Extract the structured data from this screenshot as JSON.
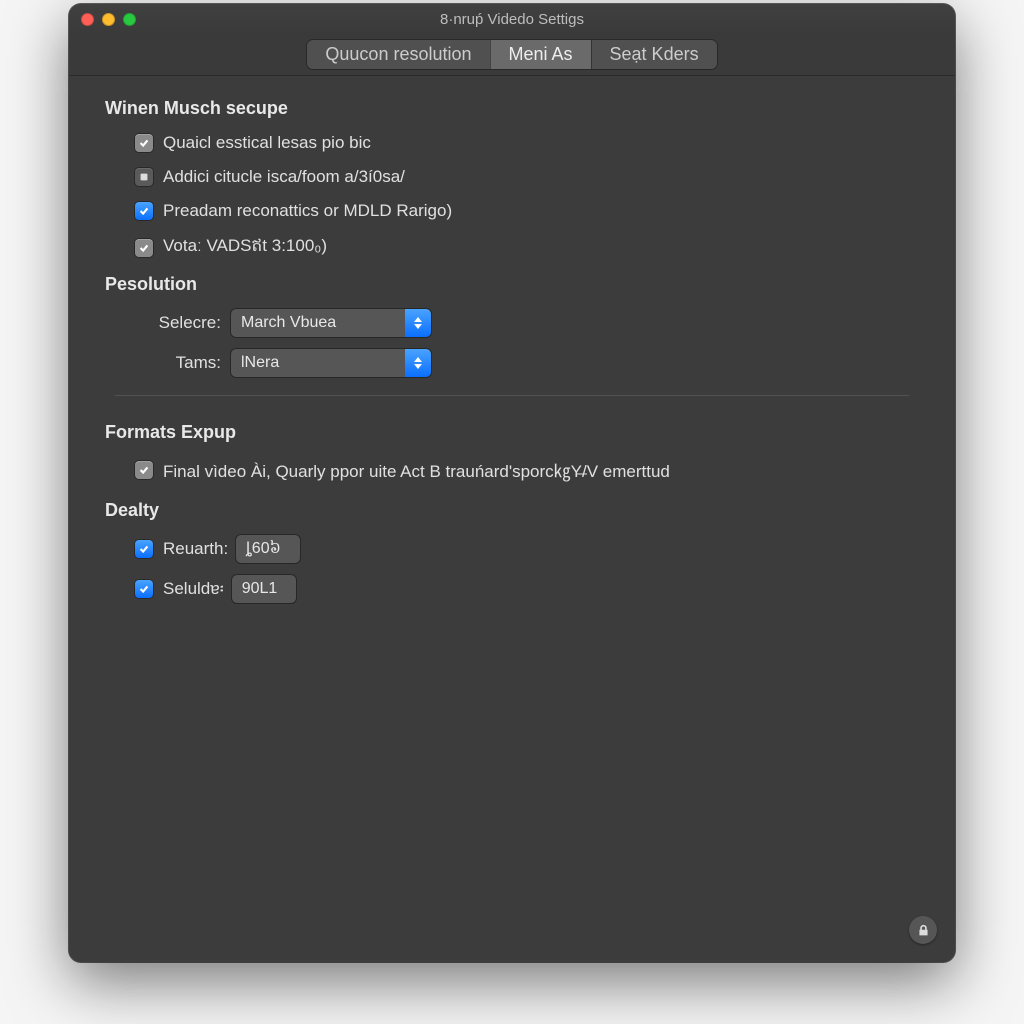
{
  "window": {
    "title": "8·nruṕ Videdo Settigs"
  },
  "tabs": [
    {
      "label": "Quucon resolution",
      "active": false
    },
    {
      "label": "Meni As",
      "active": true
    },
    {
      "label": "Seạt Kders",
      "active": false
    }
  ],
  "section1": {
    "heading": "Winen Musch secupe",
    "items": [
      {
        "label": "Quaicl esstical lesas pio bic",
        "style": "gray",
        "checked": true
      },
      {
        "label": "Addici citucle isca/foom a/3í0sa/",
        "style": "neutral",
        "checked": false
      },
      {
        "label": "Preadam reconattics or MDLD Rarigo)",
        "style": "blue",
        "checked": true
      },
      {
        "label": "Votaː VADSឥt 3:100₀)",
        "style": "gray",
        "checked": true
      }
    ]
  },
  "resolution": {
    "heading": "Pesolution",
    "rows": [
      {
        "label": "Selecre:",
        "value": "March Vbuea"
      },
      {
        "label": "Tams:",
        "value": "lNera"
      }
    ]
  },
  "formats": {
    "heading": "Formats Expup",
    "item": {
      "label": "Final vìdeo Ài, Quarly ppor uite Act B trauńard'sporc㎏Y̶/V emerttud",
      "checked": true
    }
  },
  "dealty": {
    "heading": "Dealty",
    "rows": [
      {
        "label": "Reuarth:",
        "value": "ȴ60៦",
        "checked": true
      },
      {
        "label": "Seluldɐ፡",
        "value": "90L1",
        "checked": true
      }
    ]
  }
}
